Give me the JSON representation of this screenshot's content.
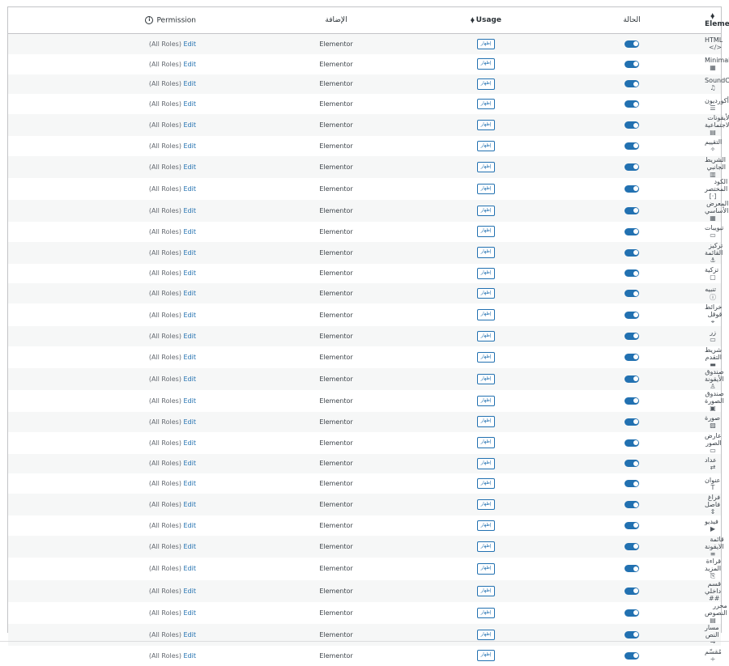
{
  "headers": {
    "element": "Element",
    "status": "الحالة",
    "usage": "Usage",
    "plugin": "الإضافة",
    "permission": "Permission"
  },
  "icons": {
    "sort": "sort-arrows-icon",
    "info": "info-icon"
  },
  "row_common": {
    "plugin": "Elementor",
    "usage_button": "إظهار",
    "permission_roles": "(All Roles)",
    "edit_label": "Edit"
  },
  "colors": {
    "accent": "#2271b1",
    "border": "#c3c4c7",
    "row_alt": "#f6f7f7"
  },
  "rows": [
    {
      "name": "HTML",
      "icon": "code-icon",
      "glyph": "</>"
    },
    {
      "name": "Minimalist",
      "icon": "calendar-icon",
      "glyph": "▦"
    },
    {
      "name": "SoundCloud",
      "icon": "headphones-icon",
      "glyph": "♫"
    },
    {
      "name": "أكورديون",
      "icon": "accordion-icon",
      "glyph": "☰"
    },
    {
      "name": "الأيقونات الاجتماعية",
      "icon": "social-icons-icon",
      "glyph": "▤"
    },
    {
      "name": "التقييم",
      "icon": "rating-icon",
      "glyph": "✧"
    },
    {
      "name": "الشريط الجانبي",
      "icon": "sidebar-icon",
      "glyph": "▥"
    },
    {
      "name": "الكود المختصر",
      "icon": "shortcode-icon",
      "glyph": "[·]"
    },
    {
      "name": "المعرض الأساسي",
      "icon": "gallery-icon",
      "glyph": "▦"
    },
    {
      "name": "تبويبات",
      "icon": "tabs-icon",
      "glyph": "▭"
    },
    {
      "name": "تركيز القائمة",
      "icon": "anchor-icon",
      "glyph": "⚓"
    },
    {
      "name": "تزكية",
      "icon": "testimonial-icon",
      "glyph": "▢"
    },
    {
      "name": "تنبيه",
      "icon": "alert-icon",
      "glyph": "ⓘ"
    },
    {
      "name": "خرائط قوقل",
      "icon": "map-icon",
      "glyph": "⌖"
    },
    {
      "name": "زر",
      "icon": "button-icon",
      "glyph": "▭"
    },
    {
      "name": "شريط التقدم",
      "icon": "progress-icon",
      "glyph": "▬"
    },
    {
      "name": "صندوق الأيقونة",
      "icon": "icon-box-icon",
      "glyph": "♙"
    },
    {
      "name": "صندوق الصورة",
      "icon": "image-box-icon",
      "glyph": "▣"
    },
    {
      "name": "صورة",
      "icon": "image-icon",
      "glyph": "▨"
    },
    {
      "name": "عارض الصور",
      "icon": "carousel-icon",
      "glyph": "▭"
    },
    {
      "name": "عداد",
      "icon": "counter-icon",
      "glyph": "⇄"
    },
    {
      "name": "عنوان",
      "icon": "heading-icon",
      "glyph": "T"
    },
    {
      "name": "فراغ فاصل",
      "icon": "spacer-icon",
      "glyph": "⇕"
    },
    {
      "name": "فيديو",
      "icon": "video-icon",
      "glyph": "▶"
    },
    {
      "name": "قائمة الايقونة",
      "icon": "icon-list-icon",
      "glyph": "≡"
    },
    {
      "name": "قراءة المزيد",
      "icon": "read-more-icon",
      "glyph": "⎘"
    },
    {
      "name": "قسم داخلي",
      "icon": "inner-section-icon",
      "glyph": "##"
    },
    {
      "name": "محرر النصوص",
      "icon": "text-editor-icon",
      "glyph": "▤"
    },
    {
      "name": "مسار النص",
      "icon": "text-path-icon",
      "glyph": "⇝"
    },
    {
      "name": "مُقسّم",
      "icon": "divider-icon",
      "glyph": "÷"
    }
  ]
}
